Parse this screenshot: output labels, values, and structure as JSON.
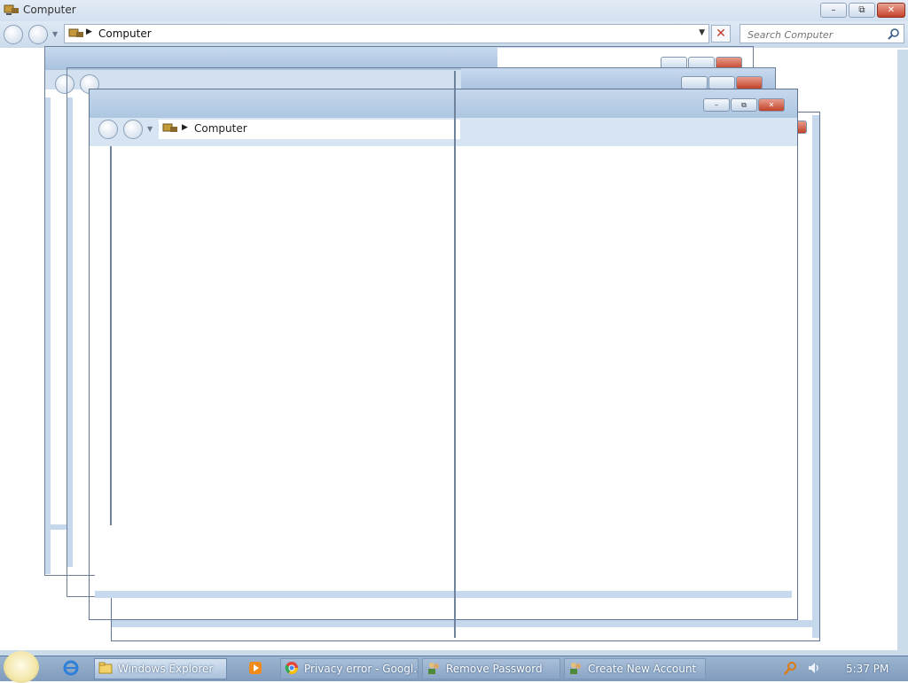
{
  "window": {
    "title": "Computer",
    "breadcrumb": "Computer",
    "search_placeholder": "Search Computer",
    "minimize_glyph": "–",
    "maximize_glyph": "⧉",
    "close_glyph": "✕"
  },
  "front_window": {
    "breadcrumb": "Computer"
  },
  "taskbar": {
    "items": [
      {
        "label": "Windows Explorer",
        "icon": "folder-icon"
      },
      {
        "label": "",
        "icon": "media-player-icon"
      },
      {
        "label": "Privacy error - Googl...",
        "icon": "chrome-icon"
      },
      {
        "label": "Remove Password",
        "icon": "user-accounts-icon"
      },
      {
        "label": "Create New Account",
        "icon": "user-accounts-icon"
      }
    ],
    "clock": "5:37 PM"
  },
  "colors": {
    "accent": "#aec6e1",
    "close": "#c7422c",
    "taskbar": "#8aa5c6"
  }
}
